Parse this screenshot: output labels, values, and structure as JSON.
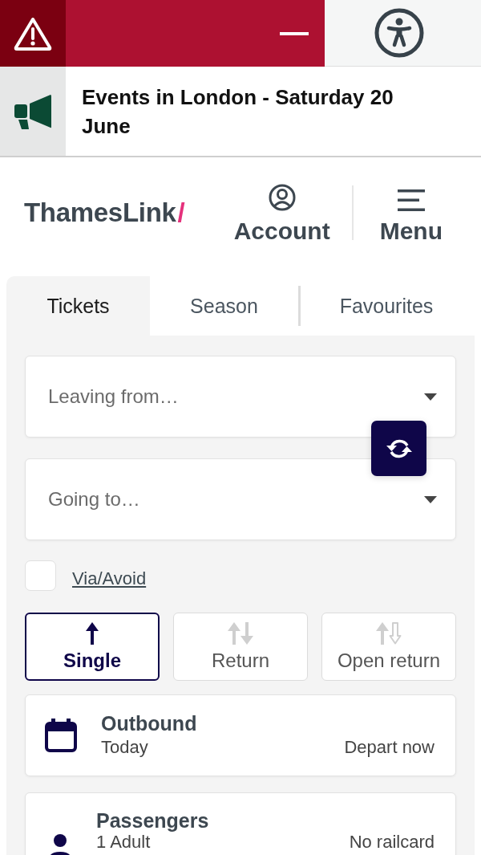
{
  "announcement": {
    "text": "Events in London - Saturday 20 June"
  },
  "header": {
    "logo": {
      "name": "ThamesLink",
      "mark": "/"
    },
    "nav": [
      {
        "kind": "account",
        "label": "Account"
      },
      {
        "kind": "menu",
        "label": "Menu"
      }
    ]
  },
  "tabs": [
    {
      "label": "Tickets",
      "selected": true
    },
    {
      "label": "Season",
      "selected": false
    },
    {
      "label": "Favourites",
      "selected": false
    }
  ],
  "journey": {
    "from": {
      "placeholder": "Leaving from…"
    },
    "to": {
      "placeholder": "Going to…"
    },
    "via": {
      "label": "Via/Avoid",
      "checked": false
    },
    "ticket_types": [
      {
        "kind": "single",
        "label": "Single",
        "selected": true
      },
      {
        "kind": "return",
        "label": "Return",
        "selected": false
      },
      {
        "kind": "open_return",
        "label": "Open return",
        "selected": false
      }
    ],
    "outbound": {
      "title": "Outbound",
      "date": "Today",
      "time": "Depart now"
    },
    "passengers": {
      "title": "Passengers",
      "count": "1 Adult",
      "railcard": "No railcard"
    }
  }
}
